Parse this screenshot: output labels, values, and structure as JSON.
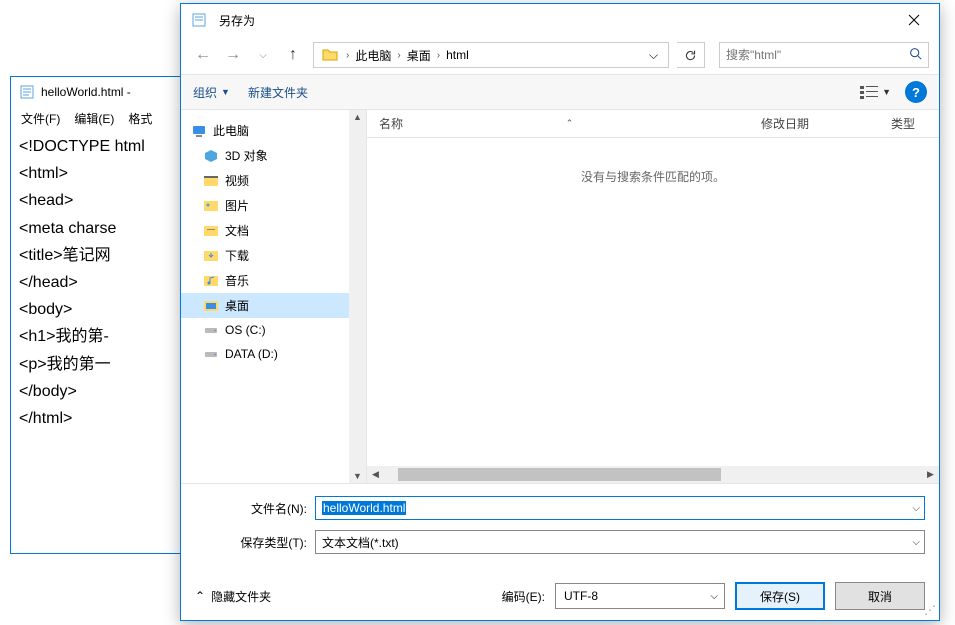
{
  "notepad": {
    "title": "helloWorld.html -",
    "menus": [
      "文件(F)",
      "编辑(E)",
      "格式"
    ],
    "lines": [
      "<!DOCTYPE html",
      "  <html>",
      "  <head>",
      "    <meta charse",
      "    <title>笔记网",
      "  </head>",
      "  <body>",
      "    <h1>我的第-",
      "    <p>我的第一",
      "  </body>",
      "</html>"
    ]
  },
  "dialog": {
    "title": "另存为",
    "breadcrumb": [
      "此电脑",
      "桌面",
      "html"
    ],
    "search_placeholder": "搜索\"html\"",
    "toolbar": {
      "organize": "组织",
      "new_folder": "新建文件夹"
    },
    "tree": {
      "root": "此电脑",
      "items": [
        {
          "label": "3D 对象",
          "icon": "3d"
        },
        {
          "label": "视频",
          "icon": "video"
        },
        {
          "label": "图片",
          "icon": "pictures"
        },
        {
          "label": "文档",
          "icon": "documents"
        },
        {
          "label": "下载",
          "icon": "downloads"
        },
        {
          "label": "音乐",
          "icon": "music"
        },
        {
          "label": "桌面",
          "icon": "desktop",
          "selected": true
        },
        {
          "label": "OS (C:)",
          "icon": "drive"
        },
        {
          "label": "DATA (D:)",
          "icon": "drive"
        }
      ]
    },
    "columns": {
      "name": "名称",
      "date": "修改日期",
      "type": "类型"
    },
    "empty_text": "没有与搜索条件匹配的项。",
    "filename_label": "文件名(N):",
    "filename_value": "helloWorld.html",
    "filetype_label": "保存类型(T):",
    "filetype_value": "文本文档(*.txt)",
    "hide_folders": "隐藏文件夹",
    "encoding_label": "编码(E):",
    "encoding_value": "UTF-8",
    "save_btn": "保存(S)",
    "cancel_btn": "取消"
  }
}
